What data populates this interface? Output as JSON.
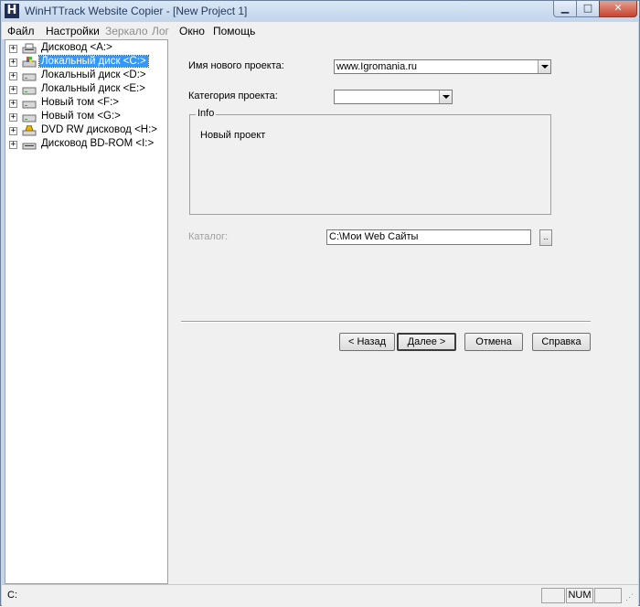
{
  "window": {
    "title": "WinHTTrack Website Copier - [New Project 1]",
    "app_icon_glyph": "H"
  },
  "menu": [
    {
      "label": "Файл",
      "enabled": true
    },
    {
      "label": "Настройки",
      "enabled": true
    },
    {
      "label": "Зеркало",
      "enabled": false
    },
    {
      "label": "Лог",
      "enabled": false
    },
    {
      "label": "Окно",
      "enabled": true
    },
    {
      "label": "Помощь",
      "enabled": true
    }
  ],
  "tree": {
    "expander": "+",
    "items": [
      {
        "label": "Дисковод <A:>",
        "icon": "floppy-drive-icon",
        "selected": false
      },
      {
        "label": "Локальный диск <C:>",
        "icon": "system-drive-icon",
        "selected": true
      },
      {
        "label": "Локальный диск <D:>",
        "icon": "hard-drive-icon",
        "selected": false
      },
      {
        "label": "Локальный диск <E:>",
        "icon": "hard-drive-icon",
        "selected": false
      },
      {
        "label": "Новый том <F:>",
        "icon": "hard-drive-icon",
        "selected": false
      },
      {
        "label": "Новый том <G:>",
        "icon": "hard-drive-icon",
        "selected": false
      },
      {
        "label": "DVD RW дисковод <H:>",
        "icon": "dvd-drive-icon",
        "selected": false
      },
      {
        "label": "Дисковод BD-ROM <I:>",
        "icon": "bd-rom-drive-icon",
        "selected": false
      }
    ]
  },
  "form": {
    "project_name_label": "Имя нового проекта:",
    "project_name_value": "www.Igromania.ru",
    "category_label": "Категория проекта:",
    "category_value": "",
    "info_title": "Info",
    "info_text": "Новый проект",
    "catalog_label": "Каталог:",
    "catalog_value": "C:\\Мои Web Сайты",
    "browse_label": ".."
  },
  "buttons": {
    "back": "< Назад",
    "next": "Далее >",
    "cancel": "Отмена",
    "help": "Справка"
  },
  "status": {
    "text": "C:",
    "num": "NUM"
  },
  "colors": {
    "selection": "#3399ff",
    "frame": "#c5d6ea"
  }
}
